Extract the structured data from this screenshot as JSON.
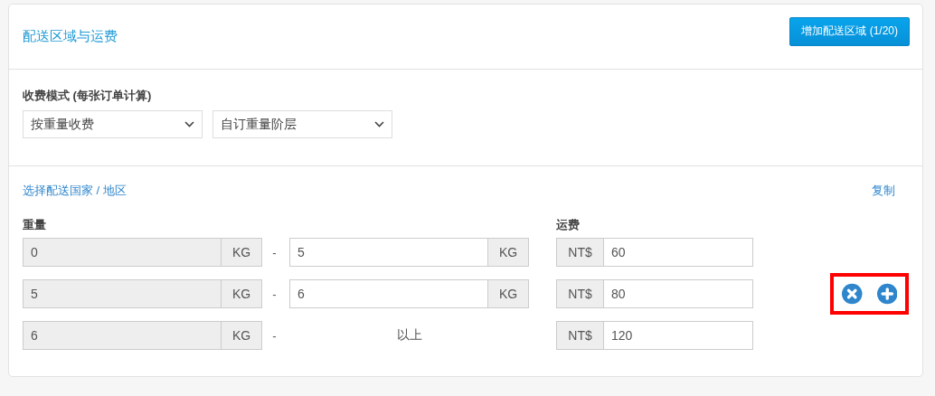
{
  "header": {
    "title": "配送区域与运费",
    "add_button": "增加配送区域 (1/20)"
  },
  "fee_mode": {
    "label": "收费模式 (每张订单计算)",
    "selects": [
      {
        "value": "按重量收费"
      },
      {
        "value": "自订重量阶层"
      }
    ]
  },
  "region": {
    "link": "选择配送国家 / 地区",
    "copy": "复制"
  },
  "columns": {
    "weight": "重量",
    "fee": "运费"
  },
  "rows": [
    {
      "kind": "range",
      "from": "0",
      "from_unit": "KG",
      "dash": "-",
      "to": "5",
      "to_unit": "KG",
      "currency": "NT$",
      "fee": "60",
      "actions": false,
      "highlighted": false
    },
    {
      "kind": "range",
      "from": "5",
      "from_unit": "KG",
      "dash": "-",
      "to": "6",
      "to_unit": "KG",
      "currency": "NT$",
      "fee": "80",
      "actions": true,
      "highlighted": true
    },
    {
      "kind": "open",
      "from": "6",
      "from_unit": "KG",
      "dash": "-",
      "to_text": "以上",
      "currency": "NT$",
      "fee": "120",
      "actions": false,
      "highlighted": false
    }
  ]
}
